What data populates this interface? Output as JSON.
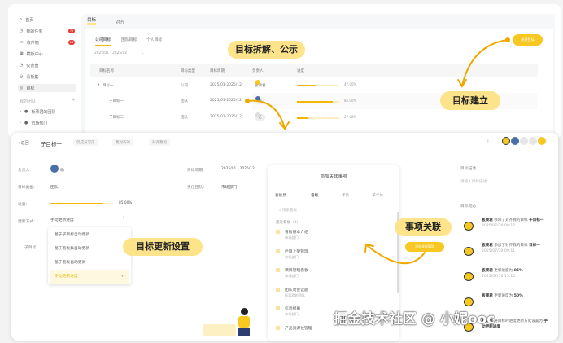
{
  "sidebar": {
    "items": [
      {
        "label": "首页",
        "icon": "home-icon"
      },
      {
        "label": "我的任务",
        "badge": "79",
        "icon": "clock-icon"
      },
      {
        "label": "收件箱",
        "badge": "24",
        "icon": "inbox-icon"
      },
      {
        "label": "模板中心",
        "icon": "grid-icon"
      },
      {
        "label": "仪表盘",
        "icon": "chart-icon"
      },
      {
        "label": "看板集",
        "icon": "layers-icon"
      },
      {
        "label": "目标",
        "icon": "target-icon"
      }
    ],
    "team_section": "我的团队",
    "add": "+",
    "teams": [
      "板栗君的团队",
      "市场部门"
    ]
  },
  "top": {
    "tabs": [
      "目标",
      "对齐"
    ],
    "subtabs": [
      "公司目标",
      "团队目标",
      "个人目标"
    ],
    "period": "2025/01 - 2025/12",
    "new_button": "新建目标",
    "columns": [
      "目标名称",
      "目标类型",
      "目标周期",
      "负责人",
      "进度"
    ],
    "rows": [
      {
        "name": "目标一",
        "type": "公司",
        "period": "2025/01-2025/12",
        "owner": "板栗君",
        "progress": 47,
        "progress_label": "47.00%"
      },
      {
        "name": "子目标一",
        "type": "团队",
        "period": "2025/01-2025/12",
        "owner": "杨",
        "progress": 85,
        "progress_label": "85.00%"
      },
      {
        "name": "子目标二",
        "type": "团队",
        "period": "2025/01-2025/12",
        "owner": "花",
        "progress": 27,
        "progress_label": "27.00%"
      }
    ]
  },
  "callouts": {
    "decompose": "目标拆解、公示",
    "create": "目标建立",
    "update": "目标更新设置",
    "link": "事项关联"
  },
  "detail": {
    "back": "返回",
    "title": "子目标一",
    "chips": [
      "仅成员可见",
      "我对齐的",
      "对齐我的"
    ],
    "more": "⋮",
    "owner_label": "负责人:",
    "owner": "杨",
    "type_label": "目标类型:",
    "type": "团队",
    "progress_label": "进度:",
    "progress": 85,
    "progress_text": "85.00%",
    "update_label": "更新方式:",
    "update_value": "手动更新进度",
    "period_label": "目标周期:",
    "period": "2025/01 - 2025/12",
    "team_label": "责任团队:",
    "team": "市场部门",
    "sub_label": "子目标",
    "options": [
      "基于子目标自动更新",
      "基于看板集自动更新",
      "基于看板自动更新",
      "手动更新进度"
    ],
    "desc_label": "目标描述",
    "desc_placeholder": "请输入目标描述",
    "feed_label": "目标动态",
    "feed": [
      {
        "user": "板栗君",
        "action": "移除了对齐我的目标",
        "target": "子目标一",
        "time": "2025/07/30 09:12"
      },
      {
        "user": "板栗君",
        "action": "添加了对齐我的目标",
        "target": "目标一",
        "time": "2025/07/30 09:11"
      },
      {
        "user": "板栗君",
        "action": "更新进度为",
        "target": "85%",
        "time": "2025/07/16 15:10"
      },
      {
        "user": "板栗君",
        "action": "更新进度为",
        "target": "50%",
        "time": ""
      },
      {
        "user": "板栗君",
        "action": "将目标的进度更新方式设置为",
        "target": "手动更新进度",
        "time": ""
      }
    ]
  },
  "link_panel": {
    "title": "添加关联事项",
    "tabs": [
      "看板集",
      "看板",
      "卡片",
      "子卡片"
    ],
    "search_placeholder": "搜索看板",
    "recent": "最近看板（3）",
    "items": [
      {
        "name": "看板基本介绍",
        "team": "市场部门"
      },
      {
        "name": "栏目上架管理",
        "team": "市场部门"
      },
      {
        "name": "项目管理看板",
        "team": "市场部门"
      },
      {
        "name": "团队周会议题",
        "team": "板栗君的团队"
      },
      {
        "name": "信息招募",
        "team": "市场部门"
      },
      {
        "name": "产品资源位管理",
        "team": ""
      }
    ],
    "add_button": "添加关联事项"
  },
  "watermark": "掘金技术社区 @ 小妮ooc",
  "colors": {
    "accent": "#f5b800",
    "callout": "#fde48a"
  }
}
